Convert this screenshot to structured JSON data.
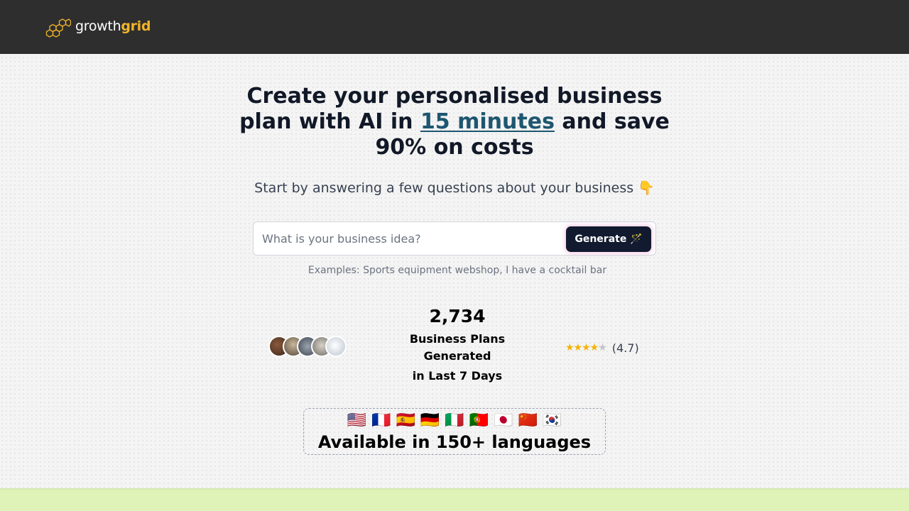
{
  "brand": {
    "name_plain": "growth",
    "name_accent": "grid"
  },
  "hero": {
    "headline_part1": "Create your personalised business plan with AI in ",
    "headline_highlight": "15 minutes",
    "headline_part2": " and save 90% on costs",
    "subline": "Start by answering a few questions about your business 👇"
  },
  "search": {
    "placeholder": "What is your business idea?",
    "value": "",
    "generate_label": "Generate 🪄"
  },
  "examples_text": "Examples: Sports equipment webshop, I have a cocktail bar",
  "stats": {
    "count": "2,734",
    "label": "Business Plans Generated",
    "sublabel": "in Last 7 Days"
  },
  "rating": {
    "stars": "★★★★",
    "half_star": "★",
    "value": "(4.7)"
  },
  "languages": {
    "flags": "🇺🇸 🇫🇷 🇪🇸 🇩🇪 🇮🇹 🇵🇹 🇯🇵 🇨🇳 🇰🇷",
    "text": "Available in 150+ languages"
  },
  "colors": {
    "topbar": "#2e2e2e",
    "accent_gold": "#f0b429",
    "highlight_blue": "#1e5670",
    "button_dark": "#111a2e",
    "bottom_strip": "#dff2b8"
  }
}
